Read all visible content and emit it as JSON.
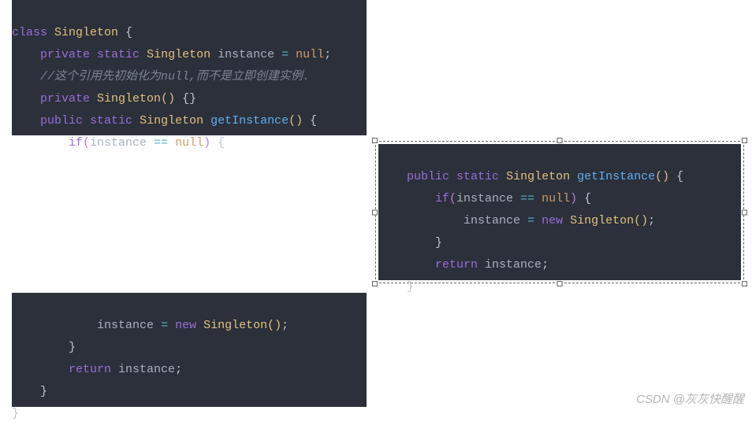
{
  "block1": {
    "l1": {
      "a": "class",
      "b": "Singleton",
      "c": "{"
    },
    "l2": {
      "a": "private",
      "b": "static",
      "c": "Singleton",
      "d": "instance",
      "e": "=",
      "f": "null",
      "g": ";"
    },
    "l3": {
      "a": "//这个引用先初始化为null,而不是立即创建实例."
    },
    "l4": {
      "a": "private",
      "b": "Singleton",
      "c": "()",
      "d": "{}"
    },
    "l5": {
      "a": "public",
      "b": "static",
      "c": "Singleton",
      "d": "getInstance",
      "e": "()",
      "f": "{"
    },
    "l6": {
      "a": "if",
      "b": "(",
      "c": "instance",
      "d": "==",
      "e": "null",
      "f": ")",
      "g": "{"
    }
  },
  "block2": {
    "l1": {
      "a": "public",
      "b": "static",
      "c": "Singleton",
      "d": "getInstance",
      "e": "()",
      "f": "{"
    },
    "l2": {
      "a": "if",
      "b": "(",
      "c": "instance",
      "d": "==",
      "e": "null",
      "f": ")",
      "g": "{"
    },
    "l3": {
      "a": "instance",
      "b": "=",
      "c": "new",
      "d": "Singleton",
      "e": "()",
      "f": ";"
    },
    "l4": {
      "a": "}"
    },
    "l5": {
      "a": "return",
      "b": "instance",
      "c": ";"
    },
    "l6": {
      "a": "}"
    }
  },
  "block3": {
    "l1": {
      "a": "instance",
      "b": "=",
      "c": "new",
      "d": "Singleton",
      "e": "()",
      "f": ";"
    },
    "l2": {
      "a": "}"
    },
    "l3": {
      "a": "return",
      "b": "instance",
      "c": ";"
    },
    "l4": {
      "a": "}"
    },
    "l5": {
      "a": "}"
    }
  },
  "watermark": "CSDN @灰灰快醒醒"
}
